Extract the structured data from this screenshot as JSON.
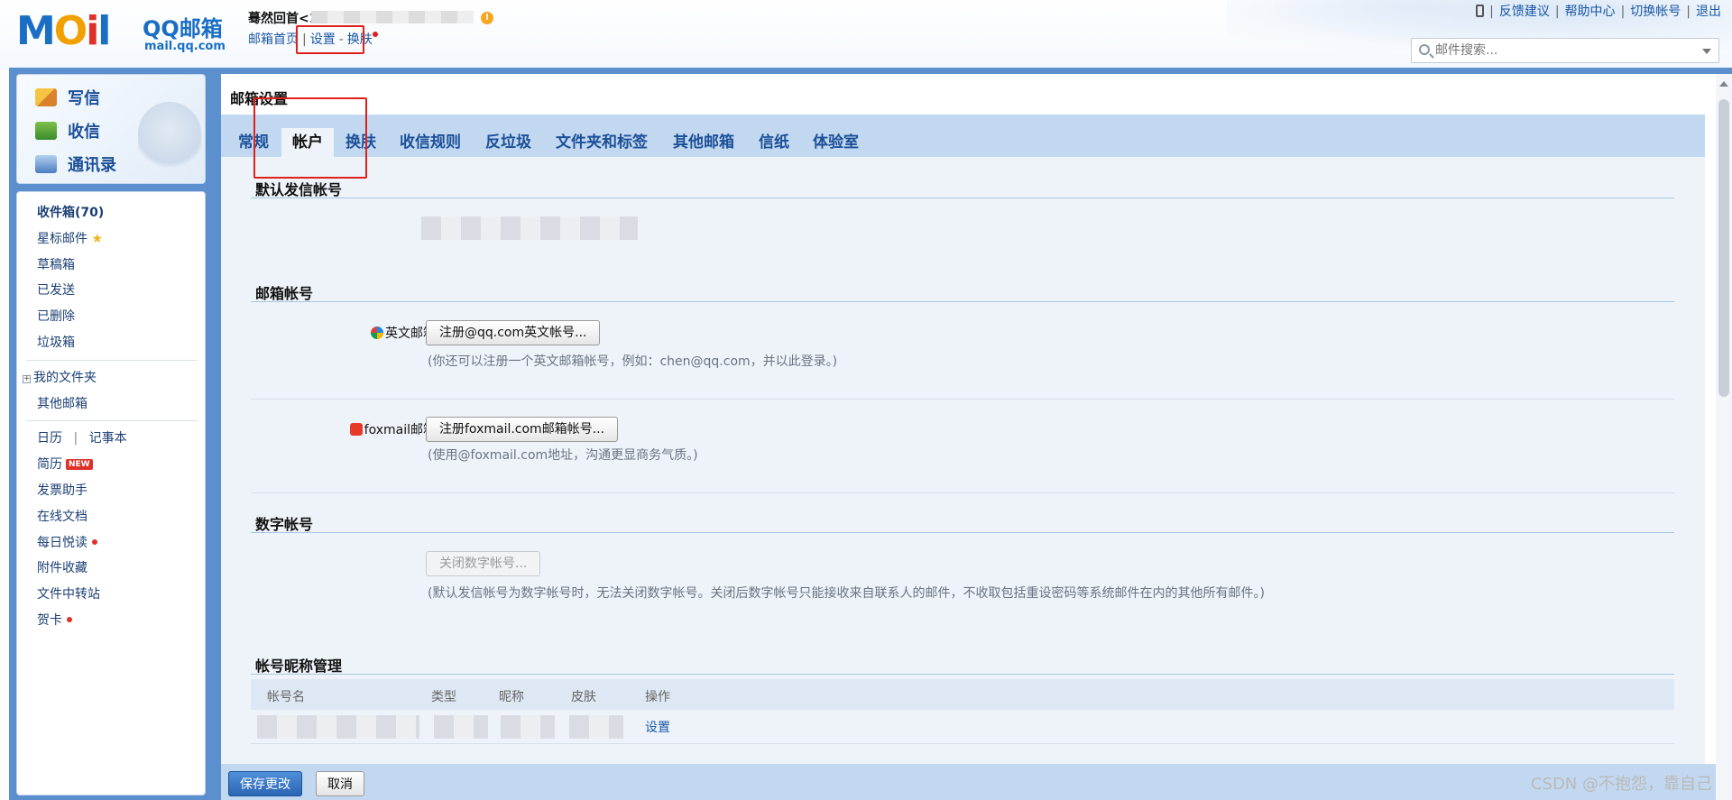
{
  "header": {
    "logo_text_m": "M",
    "logo_text_o": "O",
    "logo_text_i": "i",
    "logo_text_l": "l",
    "logo_title": "QQ邮箱",
    "logo_domain": "mail.qq.com",
    "user_name": "蓦然回首<1",
    "warning_icon_text": "!",
    "nav": {
      "home": "邮箱首页",
      "settings": "设置",
      "dash": "-",
      "skin": "换肤"
    },
    "right_links": {
      "feedback": "反馈建议",
      "help": "帮助中心",
      "switch": "切换帐号",
      "logout": "退出"
    },
    "search_placeholder": "邮件搜索..."
  },
  "compose": {
    "write": "写信",
    "receive": "收信",
    "contacts": "通讯录"
  },
  "folders": {
    "inbox": "收件箱(70)",
    "starred": "星标邮件",
    "drafts": "草稿箱",
    "sent": "已发送",
    "deleted": "已删除",
    "spam": "垃圾箱",
    "expander": "+",
    "my_folders": "我的文件夹",
    "other_mailboxes": "其他邮箱",
    "calendar": "日历",
    "bar": "|",
    "notepad": "记事本",
    "resume": "简历",
    "new_badge": "NEW",
    "invoice": "发票助手",
    "online_docs": "在线文档",
    "daily_reading": "每日悦读",
    "attachments": "附件收藏",
    "file_transfer": "文件中转站",
    "cards": "贺卡"
  },
  "settings": {
    "page_title": "邮箱设置",
    "tabs": [
      "常规",
      "帐户",
      "换肤",
      "收信规则",
      "反垃圾",
      "文件夹和标签",
      "其他邮箱",
      "信纸",
      "体验室"
    ],
    "active_tab_index": 1,
    "default_sender_title": "默认发信帐号",
    "mailbox_account_title": "邮箱帐号",
    "english_label": "英文邮箱帐号：",
    "english_button": "注册@qq.com英文帐号...",
    "english_hint": "(你还可以注册一个英文邮箱帐号，例如：chen@qq.com，并以此登录。)",
    "foxmail_label": "foxmail邮箱帐号：",
    "foxmail_button": "注册foxmail.com邮箱帐号...",
    "foxmail_hint": "(使用@foxmail.com地址，沟通更显商务气质。)",
    "digital_title": "数字帐号",
    "digital_button": "关闭数字帐号...",
    "digital_hint": "(默认发信帐号为数字帐号时，无法关闭数字帐号。关闭后数字帐号只能接收来自联系人的邮件，不收取包括重设密码等系统邮件在内的其他所有邮件。)",
    "nickname_title": "帐号昵称管理",
    "table_headers": [
      "帐号名",
      "类型",
      "昵称",
      "皮肤",
      "操作"
    ],
    "row_action": "设置",
    "save_button": "保存更改",
    "cancel_button": "取消"
  },
  "watermark": "CSDN @不抱怨，靠自己",
  "colors": {
    "brand_blue": "#1a6fc4",
    "highlight_red": "#e0201c",
    "frame_blue": "#5b8fce"
  }
}
